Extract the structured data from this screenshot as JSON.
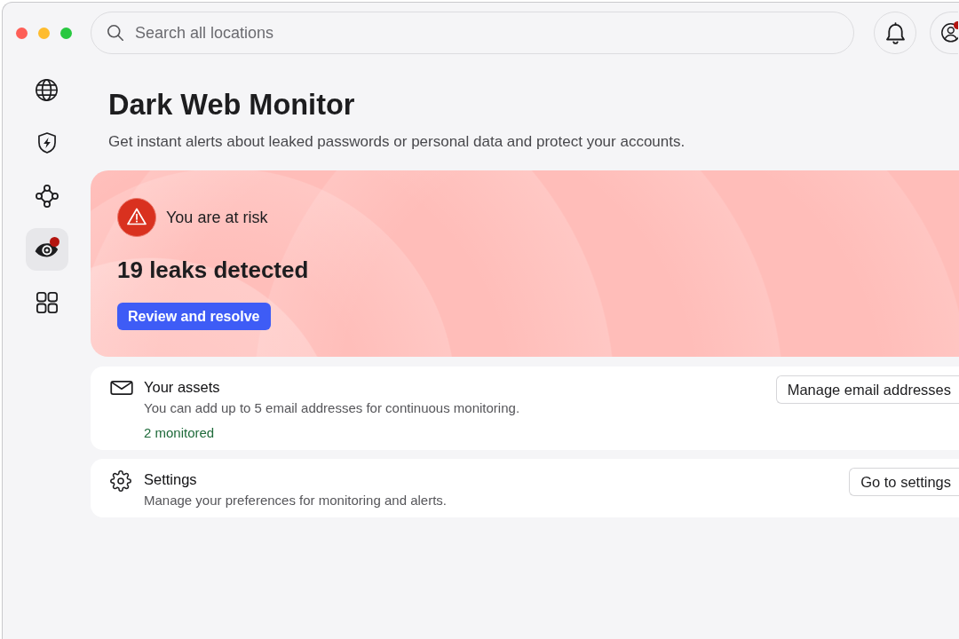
{
  "toolbar": {
    "search": {
      "placeholder": "Search all locations"
    },
    "account": {
      "alert": true
    }
  },
  "sidebar": {
    "items": [
      {
        "kind": "globe",
        "selected": false,
        "alert": false
      },
      {
        "kind": "shield",
        "selected": false,
        "alert": false
      },
      {
        "kind": "network",
        "selected": false,
        "alert": false
      },
      {
        "kind": "eye",
        "selected": true,
        "alert": true
      },
      {
        "kind": "grid",
        "selected": false,
        "alert": false
      }
    ]
  },
  "page": {
    "title": "Dark Web Monitor",
    "subtitle": "Get instant alerts about leaked passwords or personal data and protect your accounts."
  },
  "risk_card": {
    "status": "You are at risk",
    "headline": "19 leaks detected",
    "action": "Review and resolve"
  },
  "sections": [
    {
      "kind": "mail",
      "title": "Your assets",
      "description": "You can add up to 5 email addresses for continuous monitoring.",
      "note": "2 monitored",
      "action": "Manage email addresses"
    },
    {
      "kind": "gear",
      "title": "Settings",
      "description": "Manage your preferences for monitoring and alerts.",
      "action": "Go to settings"
    }
  ]
}
